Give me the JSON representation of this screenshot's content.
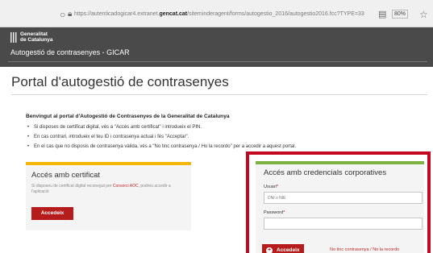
{
  "browser": {
    "url_prefix": "https://autenticadogicar4.extranet.",
    "url_domain": "gencat.cat",
    "url_suffix": "/siteminderagent/forms/autogestio_2016/autogestio2016.fcc?TYPE=33",
    "zoom": "80%"
  },
  "header": {
    "logo_line1": "Generalitat",
    "logo_line2": "de Catalunya",
    "app_title": "Autogestió de contrasenyes - GICAR"
  },
  "page": {
    "title": "Portal d'autogestió de contrasenyes",
    "welcome": "Benvingut al portal d'Autogestió de Contrasenyes de la Generalitat de Catalunya",
    "bullets": [
      "Si disposes de certificat digital, vés a \"Accés amb certificat\" i introdueix el PIN.",
      "En cas contrari, introdueix el teu ID i contrasenya actual i fés \"Acceptar\".",
      "En el cas que no disposis de contrasenya vàlida, vés a \"No tinc contrasenya / Ho la recordo\" per a accedir a aquest portal."
    ]
  },
  "cert_card": {
    "title": "Accés amb certificat",
    "desc_before": "Si disposeu de certificat digital reconegut per ",
    "desc_link": "Consorci AOC",
    "desc_after": ", podreu accedir a l'aplicació",
    "button": "Accedeix"
  },
  "cred_card": {
    "title": "Accés amb credencials corporatives",
    "user_label": "Usuari",
    "user_placeholder": "DNI o NIE",
    "password_label": "Password",
    "required_mark": "*",
    "button": "Accedeix",
    "forgot_link": "No tinc contrasenya / No la recordo"
  },
  "icons": {
    "browser": [
      "circle-icon",
      "lock-icon",
      "reader-icon",
      "star-icon"
    ],
    "login": "plus-circle-icon"
  },
  "colors": {
    "header_bg": "#4a4a4a",
    "accent_red": "#b71c1c",
    "cert_bar": "#f5b60a",
    "cred_bar": "#7cb342",
    "highlight_frame": "#c1081e"
  }
}
